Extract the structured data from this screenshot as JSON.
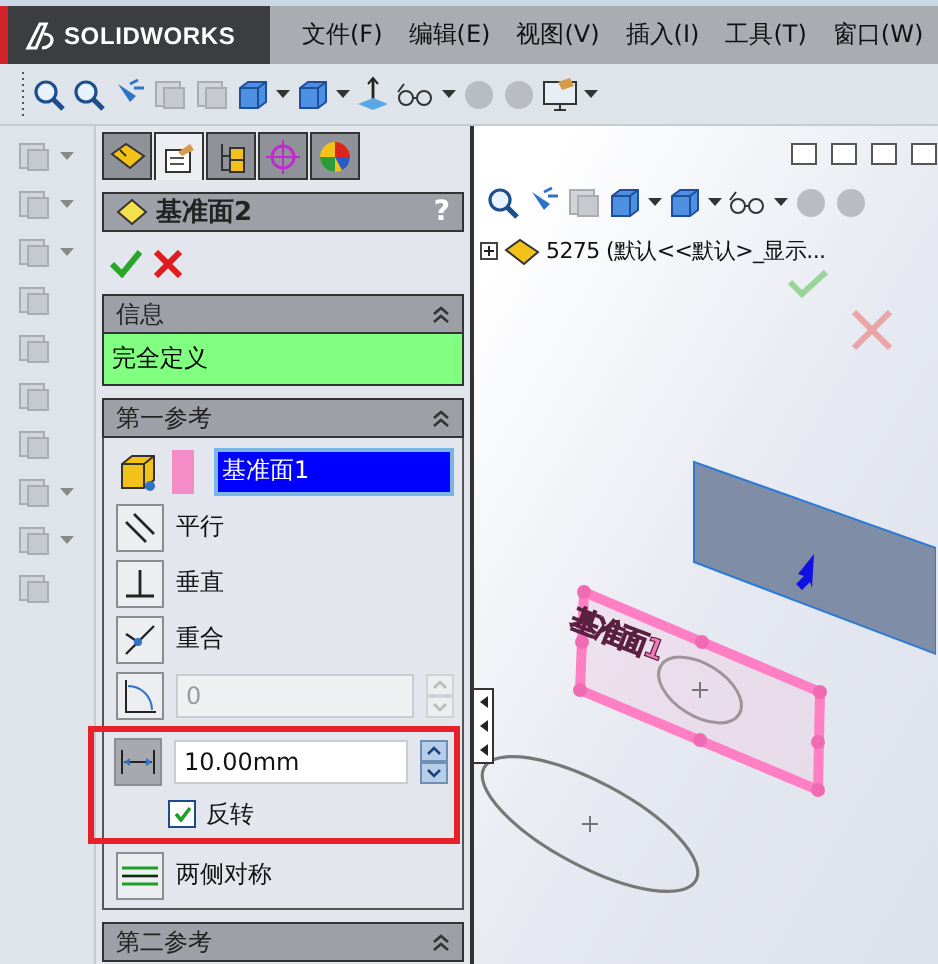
{
  "app": {
    "logo": "SOLIDWORKS"
  },
  "menu": [
    {
      "label": "文件(F)"
    },
    {
      "label": "编辑(E)"
    },
    {
      "label": "视图(V)"
    },
    {
      "label": "插入(I)"
    },
    {
      "label": "工具(T)"
    },
    {
      "label": "窗口(W)"
    }
  ],
  "property_manager": {
    "tabs": [
      {
        "selected": false
      },
      {
        "selected": true
      },
      {
        "selected": false
      },
      {
        "selected": false
      },
      {
        "selected": false
      }
    ],
    "title": "基准面2",
    "help": "?",
    "info": {
      "title": "信息",
      "message": "完全定义",
      "expanded": true
    },
    "first_reference": {
      "title": "第一参考",
      "expanded": true,
      "selection": "基准面1",
      "constraints": [
        {
          "kind": "parallel",
          "label": "平行",
          "selected": false
        },
        {
          "kind": "perpendicular",
          "label": "垂直",
          "selected": false
        },
        {
          "kind": "coincident",
          "label": "重合",
          "selected": false
        }
      ],
      "angle": {
        "value": "0",
        "disabled": true
      },
      "distance": {
        "value": "10.00mm",
        "selected": true
      },
      "flip": {
        "label": "反转",
        "checked": true
      },
      "symmetric": {
        "label": "两侧对称",
        "selected": false
      }
    },
    "second_reference": {
      "title": "第二参考",
      "expanded": true
    }
  },
  "viewport": {
    "tree_item": "5275  (默认<<默认>_显示...",
    "plane_label": "基准面1"
  }
}
